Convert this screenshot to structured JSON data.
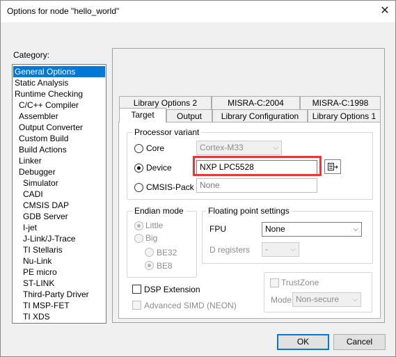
{
  "window": {
    "title": "Options for node \"hello_world\"",
    "close_glyph": "✕"
  },
  "category": {
    "label": "Category:",
    "items": [
      "General Options",
      "Static Analysis",
      "Runtime Checking",
      "C/C++ Compiler",
      "Assembler",
      "Output Converter",
      "Custom Build",
      "Build Actions",
      "Linker",
      "Debugger",
      "Simulator",
      "CADI",
      "CMSIS DAP",
      "GDB Server",
      "I-jet",
      "J-Link/J-Trace",
      "TI Stellaris",
      "Nu-Link",
      "PE micro",
      "ST-LINK",
      "Third-Party Driver",
      "TI MSP-FET",
      "TI XDS"
    ],
    "selected": "General Options"
  },
  "tabs": {
    "row1": [
      "Library Options 2",
      "MISRA-C:2004",
      "MISRA-C:1998"
    ],
    "row2": [
      "Target",
      "Output",
      "Library Configuration",
      "Library Options 1"
    ],
    "active": "Target"
  },
  "processor": {
    "group_label": "Processor variant",
    "core_label": "Core",
    "core_value": "Cortex-M33",
    "device_label": "Device",
    "device_value": "NXP LPC5528",
    "cmsis_label": "CMSIS-Pack",
    "cmsis_value": "None",
    "selected": "Device"
  },
  "endian": {
    "group_label": "Endian mode",
    "little": "Little",
    "big": "Big",
    "be32": "BE32",
    "be8": "BE8"
  },
  "fp": {
    "group_label": "Floating point settings",
    "fpu_label": "FPU",
    "fpu_value": "None",
    "dregs_label": "D registers",
    "dregs_value": "-"
  },
  "options": {
    "dsp": "DSP Extension",
    "simd": "Advanced SIMD (NEON)",
    "trustzone": "TrustZone",
    "mode_label": "Mode",
    "mode_value": "Non-secure"
  },
  "buttons": {
    "ok": "OK",
    "cancel": "Cancel"
  },
  "colors": {
    "selection": "#0078d7",
    "highlight": "#e03b3b"
  }
}
